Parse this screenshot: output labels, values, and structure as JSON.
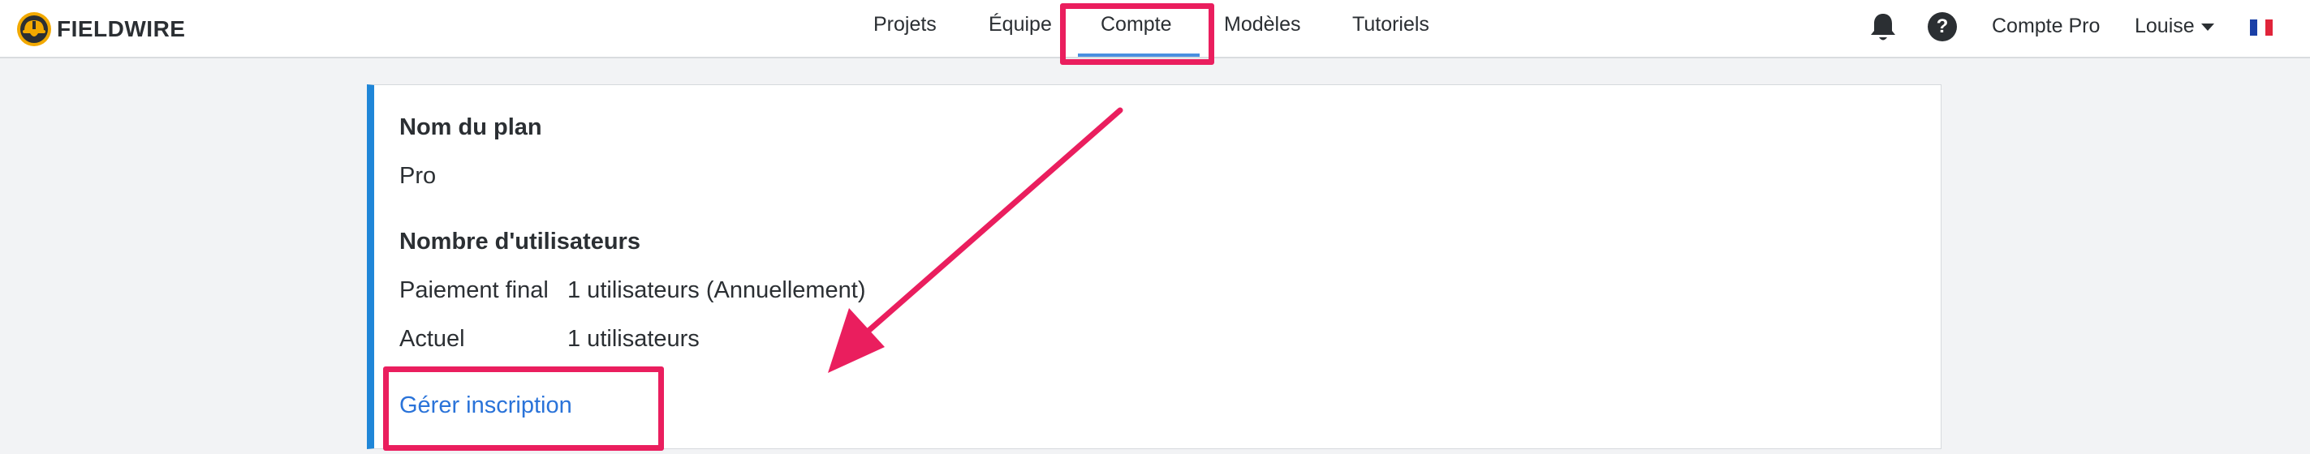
{
  "brand": {
    "name": "FIELDWIRE"
  },
  "nav": {
    "items": [
      {
        "label": "Projets"
      },
      {
        "label": "Équipe"
      },
      {
        "label": "Compte"
      },
      {
        "label": "Modèles"
      },
      {
        "label": "Tutoriels"
      }
    ],
    "active": "Compte"
  },
  "header_right": {
    "bell_icon": "bell-icon",
    "help_label": "?",
    "account_plan": "Compte Pro",
    "user_name": "Louise",
    "language_flag": "fr-flag-icon"
  },
  "colors": {
    "accent": "#1f86d8",
    "link": "#2a73d9",
    "annotation": "#ea1e5e",
    "nav_underline": "#4a8fe0"
  },
  "card": {
    "plan_name_label": "Nom du plan",
    "plan_name_value": "Pro",
    "users_label": "Nombre d'utilisateurs",
    "rows": [
      {
        "label": "Paiement final",
        "value": "1 utilisateurs (Annuellement)"
      },
      {
        "label": "Actuel",
        "value": "1 utilisateurs"
      }
    ],
    "manage_link": "Gérer inscription"
  }
}
